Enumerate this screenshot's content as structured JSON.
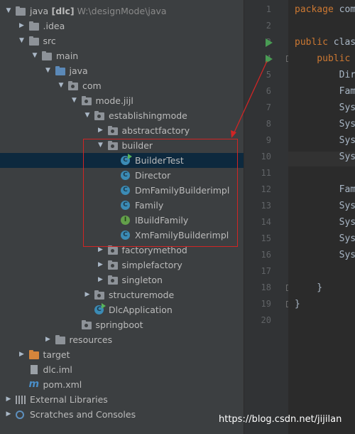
{
  "project_tree": {
    "rows": [
      {
        "name": "project-root",
        "depth": 0,
        "arrow": "down",
        "icon": "folder",
        "label": "java",
        "badge": "[dlc]",
        "path": "W:\\designMode\\java"
      },
      {
        "name": "idea-folder",
        "depth": 1,
        "arrow": "right",
        "icon": "folder",
        "label": ".idea"
      },
      {
        "name": "src-folder",
        "depth": 1,
        "arrow": "down",
        "icon": "folder",
        "label": "src"
      },
      {
        "name": "main-folder",
        "depth": 2,
        "arrow": "down",
        "icon": "folder",
        "label": "main"
      },
      {
        "name": "java-folder",
        "depth": 3,
        "arrow": "down",
        "icon": "folder-blue",
        "label": "java"
      },
      {
        "name": "com-package",
        "depth": 4,
        "arrow": "down",
        "icon": "package",
        "label": "com"
      },
      {
        "name": "modejijl-package",
        "depth": 5,
        "arrow": "down",
        "icon": "package",
        "label": "mode.jijl"
      },
      {
        "name": "establishingmode-package",
        "depth": 6,
        "arrow": "down",
        "icon": "package",
        "label": "establishingmode"
      },
      {
        "name": "abstractfactory-package",
        "depth": 7,
        "arrow": "right",
        "icon": "package",
        "label": "abstractfactory"
      },
      {
        "name": "builder-package",
        "depth": 7,
        "arrow": "down",
        "icon": "package",
        "label": "builder"
      },
      {
        "name": "buildertest-class",
        "depth": 8,
        "arrow": "",
        "icon": "class-run",
        "label": "BuilderTest",
        "selected": true
      },
      {
        "name": "director-class",
        "depth": 8,
        "arrow": "",
        "icon": "class",
        "label": "Director"
      },
      {
        "name": "dmfamilybuilderimpl-class",
        "depth": 8,
        "arrow": "",
        "icon": "class",
        "label": "DmFamilyBuilderimpl"
      },
      {
        "name": "family-class",
        "depth": 8,
        "arrow": "",
        "icon": "class",
        "label": "Family"
      },
      {
        "name": "ibuildfamily-interface",
        "depth": 8,
        "arrow": "",
        "icon": "interface",
        "label": "IBuildFamily"
      },
      {
        "name": "xmfamilybuilderimpl-class",
        "depth": 8,
        "arrow": "",
        "icon": "class",
        "label": "XmFamilyBuilderimpl"
      },
      {
        "name": "factorymethod-package",
        "depth": 7,
        "arrow": "right",
        "icon": "package",
        "label": "factorymethod"
      },
      {
        "name": "simplefactory-package",
        "depth": 7,
        "arrow": "right",
        "icon": "package",
        "label": "simplefactory"
      },
      {
        "name": "singleton-package",
        "depth": 7,
        "arrow": "right",
        "icon": "package",
        "label": "singleton"
      },
      {
        "name": "structuremode-package",
        "depth": 6,
        "arrow": "right",
        "icon": "package",
        "label": "structuremode"
      },
      {
        "name": "dlcapplication-class",
        "depth": 6,
        "arrow": "",
        "icon": "class-run",
        "label": "DlcApplication"
      },
      {
        "name": "springboot-package",
        "depth": 5,
        "arrow": "",
        "icon": "package",
        "label": "springboot"
      },
      {
        "name": "resources-folder",
        "depth": 3,
        "arrow": "right",
        "icon": "folder",
        "label": "resources"
      },
      {
        "name": "target-folder",
        "depth": 1,
        "arrow": "right",
        "icon": "folder-orange",
        "label": "target"
      },
      {
        "name": "dlc-iml-file",
        "depth": 1,
        "arrow": "",
        "icon": "file-iml",
        "label": "dlc.iml"
      },
      {
        "name": "pom-xml-file",
        "depth": 1,
        "arrow": "",
        "icon": "maven-m",
        "label": "pom.xml"
      },
      {
        "name": "external-libraries",
        "depth": 0,
        "arrow": "right",
        "icon": "library",
        "label": "External Libraries"
      },
      {
        "name": "scratches-and-consoles",
        "depth": 0,
        "arrow": "right",
        "icon": "scratches",
        "label": "Scratches and Consoles"
      }
    ]
  },
  "editor": {
    "line_numbers": [
      "1",
      "2",
      "3",
      "4",
      "5",
      "6",
      "7",
      "8",
      "9",
      "10",
      "11",
      "12",
      "13",
      "14",
      "15",
      "16",
      "17",
      "18",
      "19",
      "20"
    ],
    "lines": [
      {
        "n": 1,
        "kw": "package",
        "rest": " com"
      },
      {
        "n": 2,
        "kw": "",
        "rest": ""
      },
      {
        "n": 3,
        "kw": "public",
        "rest": " clas"
      },
      {
        "n": 4,
        "kw": "    public",
        "rest": ""
      },
      {
        "n": 5,
        "kw": "",
        "rest": "        Dir"
      },
      {
        "n": 6,
        "kw": "",
        "rest": "        Fam"
      },
      {
        "n": 7,
        "kw": "",
        "rest": "        Sys"
      },
      {
        "n": 8,
        "kw": "",
        "rest": "        Sys"
      },
      {
        "n": 9,
        "kw": "",
        "rest": "        Sys"
      },
      {
        "n": 10,
        "kw": "",
        "rest": "        Sys"
      },
      {
        "n": 11,
        "kw": "",
        "rest": ""
      },
      {
        "n": 12,
        "kw": "",
        "rest": "        Fam"
      },
      {
        "n": 13,
        "kw": "",
        "rest": "        Sys"
      },
      {
        "n": 14,
        "kw": "",
        "rest": "        Sys"
      },
      {
        "n": 15,
        "kw": "",
        "rest": "        Sys"
      },
      {
        "n": 16,
        "kw": "",
        "rest": "        Sys"
      },
      {
        "n": 17,
        "kw": "",
        "rest": ""
      },
      {
        "n": 18,
        "kw": "",
        "rest": "    }"
      },
      {
        "n": 19,
        "kw": "",
        "rest": "}"
      },
      {
        "n": 20,
        "kw": "",
        "rest": ""
      }
    ],
    "run_lines": [
      3,
      4
    ],
    "fold_lines": [
      4,
      18,
      19
    ],
    "caret_line": 10
  },
  "watermark": "https://blog.csdn.net/jijilan",
  "colors": {
    "highlight_box": "#d02525",
    "selection": "#0d293e",
    "run_marker": "#499c54"
  }
}
